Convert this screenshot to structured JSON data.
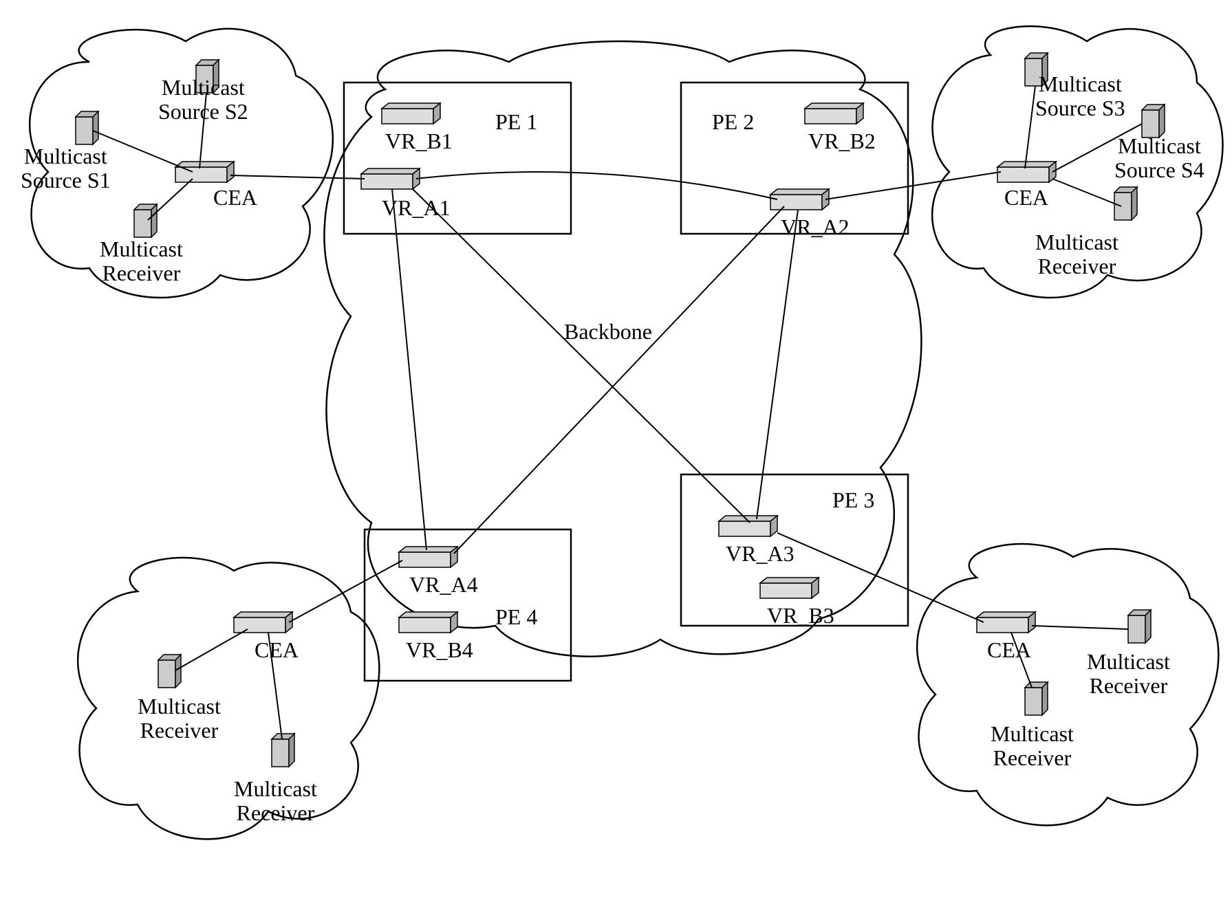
{
  "backbone_label": "Backbone",
  "pe": {
    "pe1": {
      "title": "PE 1",
      "vr_b": "VR_B1",
      "vr_a": "VR_A1"
    },
    "pe2": {
      "title": "PE 2",
      "vr_b": "VR_B2",
      "vr_a": "VR_A2"
    },
    "pe3": {
      "title": "PE 3",
      "vr_b": "VR_B3",
      "vr_a": "VR_A3"
    },
    "pe4": {
      "title": "PE 4",
      "vr_b": "VR_B4",
      "vr_a": "VR_A4"
    }
  },
  "clouds": {
    "top_left": {
      "source1": "Multicast\nSource S1",
      "source2": "Multicast\nSource S2",
      "receiver": "Multicast\nReceiver",
      "cea": "CEA"
    },
    "top_right": {
      "source3": "Multicast\nSource S3",
      "source4": "Multicast\nSource S4",
      "receiver": "Multicast\nReceiver",
      "cea": "CEA"
    },
    "bottom_left": {
      "receiver1": "Multicast\nReceiver",
      "receiver2": "Multicast\nReceiver",
      "cea": "CEA"
    },
    "bottom_right": {
      "receiver1": "Multicast\nReceiver",
      "receiver2": "Multicast\nReceiver",
      "cea": "CEA"
    }
  }
}
